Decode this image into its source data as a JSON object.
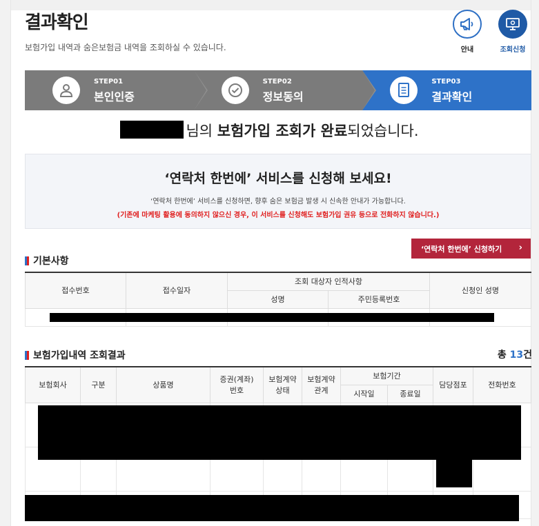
{
  "header": {
    "title": "결과확인",
    "desc": "보험가입 내역과 숨은보험금 내역을 조회하실 수 있습니다.",
    "guide_label": "안내",
    "apply_label": "조회신청"
  },
  "steps": [
    {
      "no": "STEP01",
      "name": "본인인증",
      "icon": "user-icon"
    },
    {
      "no": "STEP02",
      "name": "정보동의",
      "icon": "check-icon"
    },
    {
      "no": "STEP03",
      "name": "결과확인",
      "icon": "document-icon"
    }
  ],
  "headline": {
    "suffix1": "님의 ",
    "bold": "보험가입 조회가 완료",
    "suffix2": "되었습니다."
  },
  "promo": {
    "title": "‘연락처 한번에’ 서비스를 신청해 보세요!",
    "desc": "‘연락처 한번에’ 서비스를 신청하면, 향후 숨은 보험금 발생 시 신속한 안내가 가능합니다.",
    "warning": "(기존에 마케팅 활용에 동의하지 않으신 경우, 이 서비스를 신청해도 보험가입 권유 등으로 전화하지 않습니다.)",
    "cta": "‘연락처 한번에’ 신청하기",
    "cta_arrow": "›"
  },
  "basic": {
    "title": "기본사항",
    "headers": {
      "receipt_no": "접수번호",
      "receipt_date": "접수일자",
      "subject": "조회 대상자 인적사항",
      "name": "성명",
      "rrn": "주민등록번호",
      "applicant": "신청인 성명"
    }
  },
  "result": {
    "title": "보험가입내역 조회결과",
    "total_prefix": "총 ",
    "total_count": "13",
    "total_suffix": "건",
    "headers": {
      "company": "보험회사",
      "type": "구분",
      "product": "상품명",
      "policy_no_1": "증권(계좌)",
      "policy_no_2": "번호",
      "status_1": "보험계약",
      "status_2": "상태",
      "relation_1": "보험계약",
      "relation_2": "관계",
      "period": "보험기간",
      "start": "시작일",
      "end": "종료일",
      "branch": "담당점포",
      "phone": "전화번호"
    }
  },
  "colors": {
    "active_step": "#2e72c8",
    "inactive_step": "#7b7b7b",
    "cta": "#b3253b",
    "warning": "#e02020"
  }
}
